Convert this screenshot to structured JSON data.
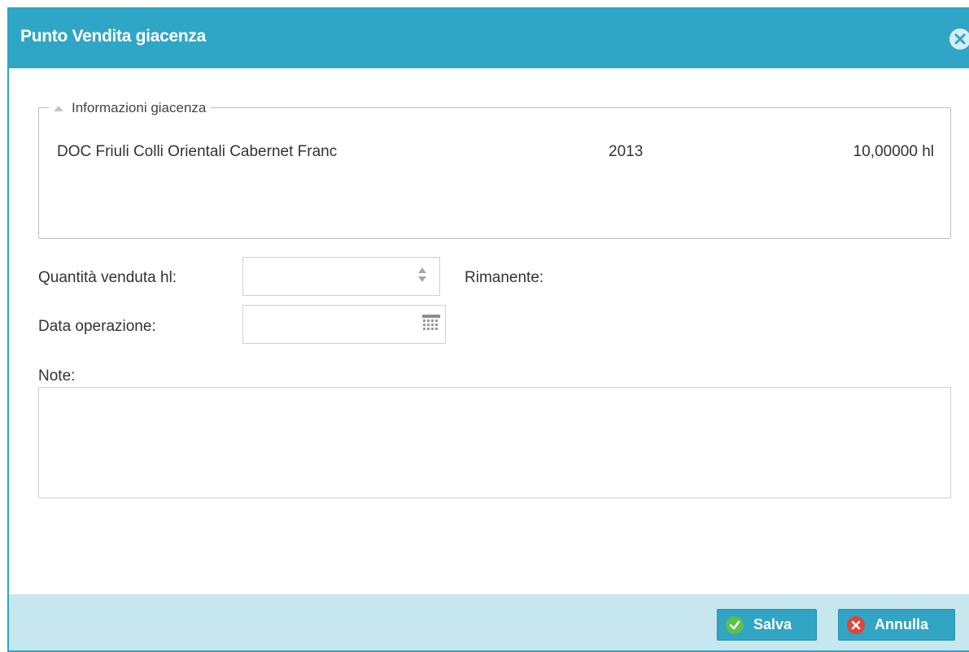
{
  "dialog": {
    "title": "Punto Vendita giacenza",
    "close_icon": "close-circle-icon"
  },
  "info": {
    "legend": "Informazioni giacenza",
    "product": "DOC Friuli Colli Orientali Cabernet Franc",
    "year": "2013",
    "quantity": "10,00000 hl"
  },
  "form": {
    "qty_label": "Quantità venduta hl:",
    "qty_value": "",
    "remaining_label": "Rimanente:",
    "date_label": "Data operazione:",
    "date_value": "",
    "notes_label": "Note:",
    "notes_value": ""
  },
  "buttons": {
    "save": "Salva",
    "cancel": "Annulla"
  },
  "colors": {
    "header": "#2fa6c6",
    "footer": "#c7e7ef",
    "button": "#32a4c4",
    "save_icon": "#5cc14a",
    "cancel_icon": "#e0443b"
  }
}
